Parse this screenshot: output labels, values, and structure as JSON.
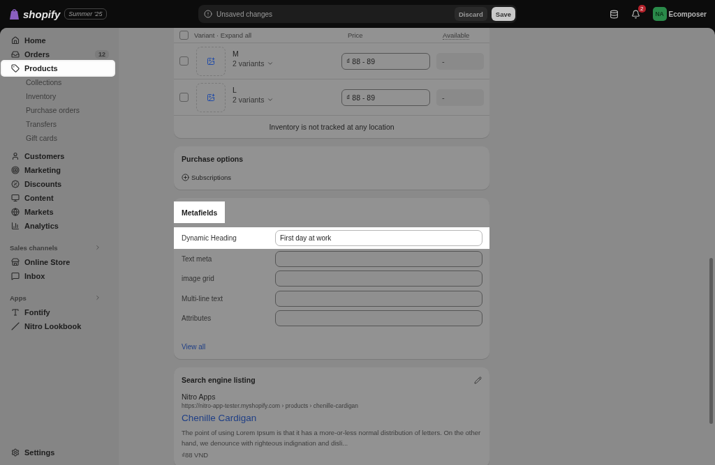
{
  "top_bar": {
    "brand": "shopify",
    "edition": "Summer '25",
    "save_bar": {
      "message": "Unsaved changes",
      "buttons": [
        {
          "label": "Discard",
          "kind": "secondary"
        },
        {
          "label": "Save",
          "kind": "primary"
        }
      ]
    },
    "notifications": "2",
    "account": {
      "initials": "NA",
      "name": "Ecomposer"
    }
  },
  "sidebar": {
    "items": [
      {
        "label": "Home",
        "selected": false
      },
      {
        "label": "Orders",
        "selected": false,
        "badge": "12"
      },
      {
        "label": "Products",
        "selected": true,
        "children": [
          {
            "label": "Collections"
          },
          {
            "label": "Inventory"
          },
          {
            "label": "Purchase orders"
          },
          {
            "label": "Transfers"
          },
          {
            "label": "Gift cards"
          }
        ]
      },
      {
        "label": "Customers",
        "selected": false
      },
      {
        "label": "Marketing",
        "selected": false
      },
      {
        "label": "Discounts",
        "selected": false
      },
      {
        "label": "Content",
        "selected": false
      },
      {
        "label": "Markets",
        "selected": false
      },
      {
        "label": "Analytics",
        "selected": false
      }
    ],
    "sections": [
      {
        "title": "Sales channels",
        "items": [
          {
            "label": "Online Store",
            "selected": false
          },
          {
            "label": "Inbox",
            "selected": false
          }
        ]
      },
      {
        "title": "Apps",
        "items": [
          {
            "label": "Fontify",
            "selected": false
          },
          {
            "label": "Nitro Lookbook",
            "selected": false
          }
        ]
      }
    ],
    "footer": {
      "label": "Settings",
      "selected": false
    }
  },
  "variants": {
    "header": {
      "checked": false,
      "variant": "Variant · Expand all",
      "price": "Price",
      "available": "Available"
    },
    "rows": [
      {
        "name": "M",
        "count": "2 variants",
        "price": "₫ 88 - 89",
        "available": "-",
        "checked": false
      },
      {
        "name": "L",
        "count": "2 variants",
        "price": "₫ 88 - 89",
        "available": "-",
        "checked": false
      }
    ],
    "footer": "Inventory is not tracked at any location"
  },
  "purchase_options": {
    "title": "Purchase options",
    "action": "Subscriptions"
  },
  "metafields": {
    "title": "Metafields",
    "spotlit": true,
    "rows": [
      {
        "label": "Dynamic Heading",
        "value": "First day at work",
        "spotlit": true
      },
      {
        "label": "Text meta",
        "spotlit": false
      },
      {
        "label": "image grid",
        "spotlit": false
      },
      {
        "label": "Multi-line text",
        "spotlit": false
      },
      {
        "label": "Attributes",
        "spotlit": false
      }
    ],
    "link": "View all"
  },
  "seo": {
    "title": "Search engine listing",
    "site": "Nitro Apps",
    "url": "https://nitro-app-tester.myshopify.com › products › chenille-cardigan",
    "page_title": "Chenille Cardigan",
    "description": "The point of using Lorem Ipsum is that it has a more-or-less normal distribution of letters. On the other hand, we denounce with righteous indignation and disli...",
    "price": "₫88 VND"
  }
}
